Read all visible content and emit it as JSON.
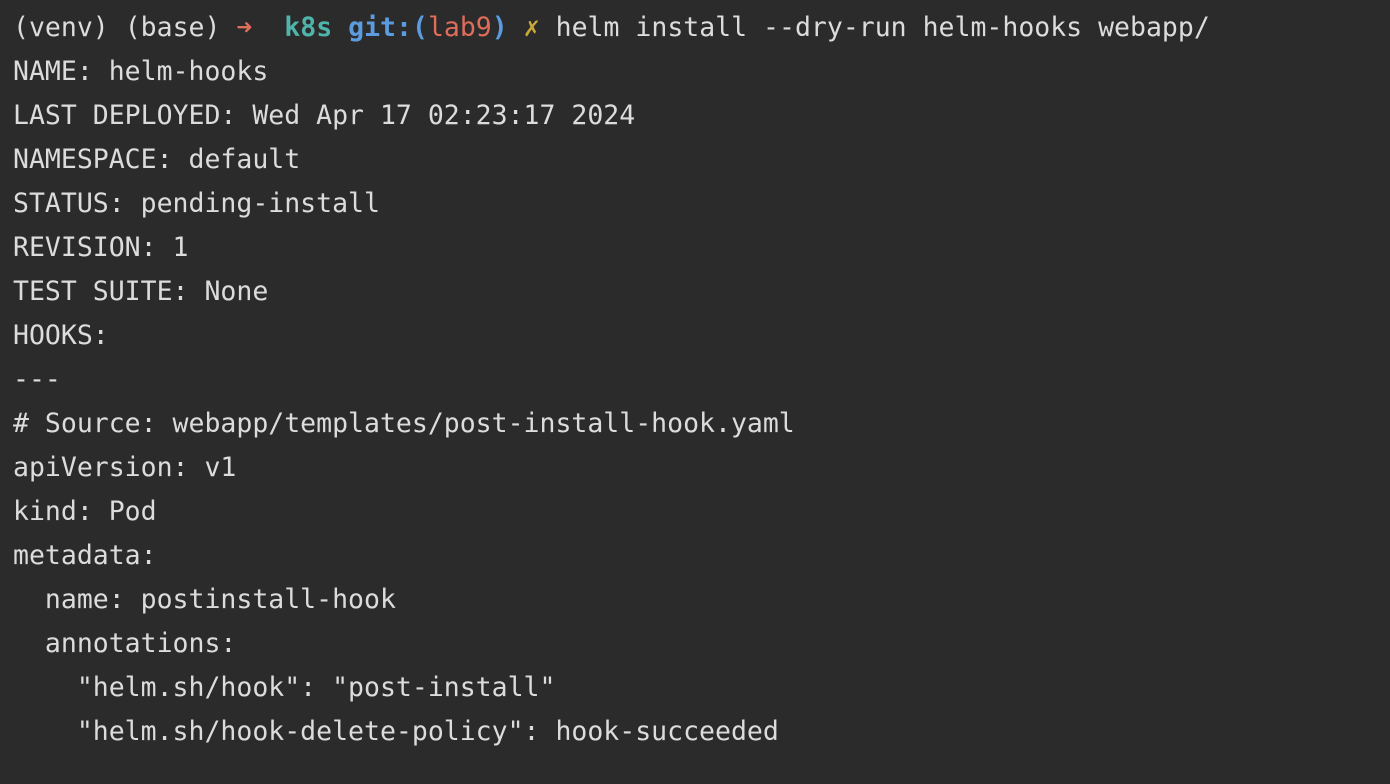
{
  "prompt": {
    "venv": "(venv)",
    "base": "(base)",
    "arrow": "➜",
    "dir": "k8s",
    "git_label": "git:",
    "paren_open": "(",
    "branch": "lab9",
    "paren_close": ")",
    "dirty": "✗",
    "command": "helm install --dry-run helm-hooks webapp/"
  },
  "colors": {
    "background": "#2b2b2b",
    "text": "#dcdcdc",
    "arrow": "#e06c5a",
    "dir": "#4fb4a9",
    "git_label": "#5b9be0",
    "branch": "#e06c5a",
    "dirty": "#c9a93a"
  },
  "output": [
    "NAME: helm-hooks",
    "LAST DEPLOYED: Wed Apr 17 02:23:17 2024",
    "NAMESPACE: default",
    "STATUS: pending-install",
    "REVISION: 1",
    "TEST SUITE: None",
    "HOOKS:",
    "---",
    "# Source: webapp/templates/post-install-hook.yaml",
    "apiVersion: v1",
    "kind: Pod",
    "metadata:",
    "  name: postinstall-hook",
    "  annotations:",
    "    \"helm.sh/hook\": \"post-install\"",
    "    \"helm.sh/hook-delete-policy\": hook-succeeded"
  ]
}
